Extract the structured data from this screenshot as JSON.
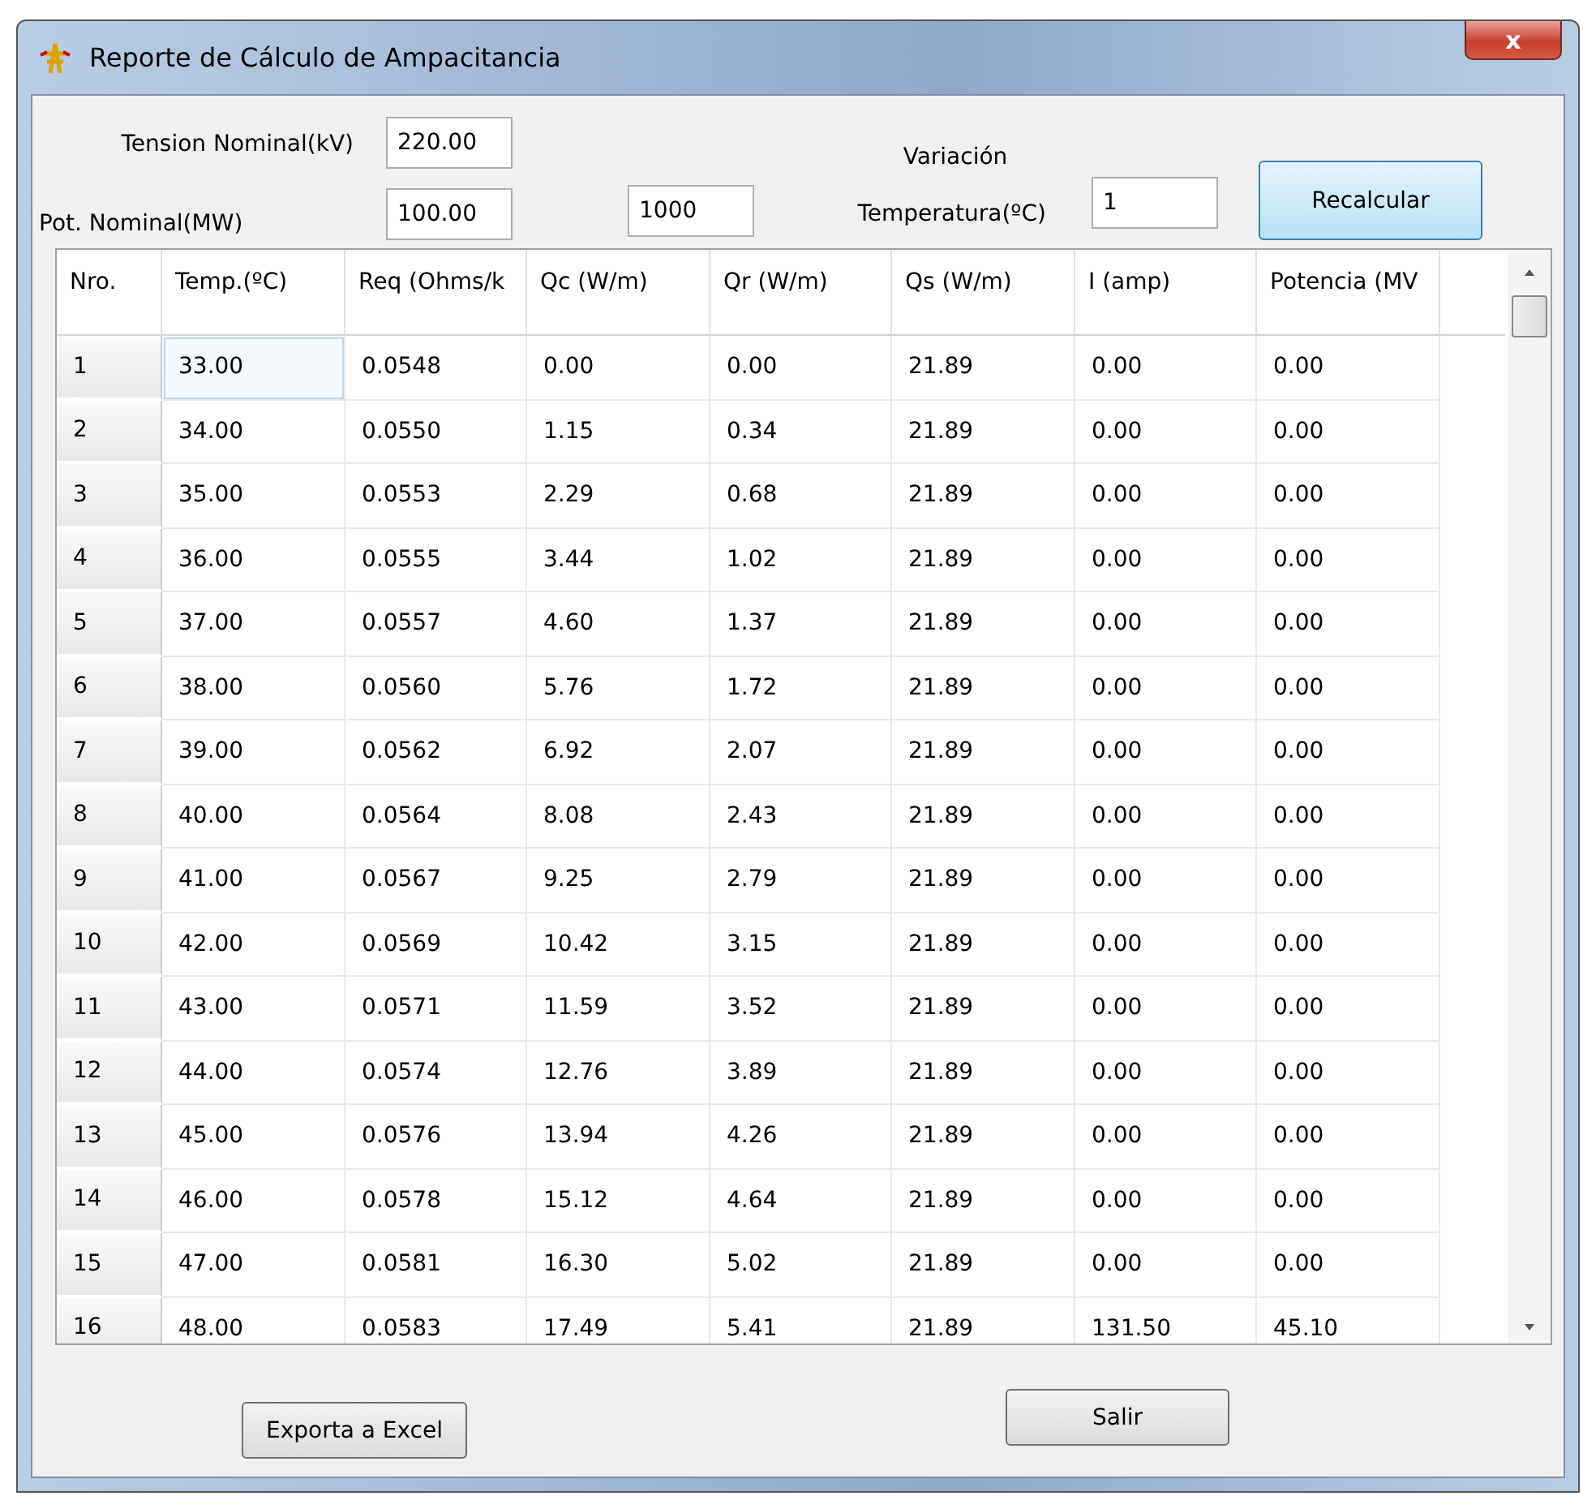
{
  "window": {
    "title": "Reporte de Cálculo de Ampacitancia",
    "close": "x"
  },
  "form": {
    "tension_label": "Tension Nominal(kV)",
    "tension_value": "220.00",
    "potencia_label": "Pot. Nominal(MW)",
    "potencia_value": "100.00",
    "field_3_value": "1000",
    "variacion_label_1": "Variación",
    "variacion_label_2": "Temperatura(ºC)",
    "variacion_value": "1",
    "recalc_button": "Recalcular"
  },
  "table": {
    "columns": [
      "Nro.",
      "Temp.(ºC)",
      "Req (Ohms/k",
      "Qc (W/m)",
      "Qr (W/m)",
      "Qs  (W/m)",
      "I (amp)",
      "Potencia (MV"
    ],
    "rows": [
      {
        "cells": [
          "1",
          "33.00",
          "0.0548",
          "0.00",
          "0.00",
          "21.89",
          "0.00",
          "0.00"
        ],
        "selected": true
      },
      {
        "cells": [
          "2",
          "34.00",
          "0.0550",
          "1.15",
          "0.34",
          "21.89",
          "0.00",
          "0.00"
        ],
        "selected": false
      },
      {
        "cells": [
          "3",
          "35.00",
          "0.0553",
          "2.29",
          "0.68",
          "21.89",
          "0.00",
          "0.00"
        ],
        "selected": false
      },
      {
        "cells": [
          "4",
          "36.00",
          "0.0555",
          "3.44",
          "1.02",
          "21.89",
          "0.00",
          "0.00"
        ],
        "selected": false
      },
      {
        "cells": [
          "5",
          "37.00",
          "0.0557",
          "4.60",
          "1.37",
          "21.89",
          "0.00",
          "0.00"
        ],
        "selected": false
      },
      {
        "cells": [
          "6",
          "38.00",
          "0.0560",
          "5.76",
          "1.72",
          "21.89",
          "0.00",
          "0.00"
        ],
        "selected": false
      },
      {
        "cells": [
          "7",
          "39.00",
          "0.0562",
          "6.92",
          "2.07",
          "21.89",
          "0.00",
          "0.00"
        ],
        "selected": false
      },
      {
        "cells": [
          "8",
          "40.00",
          "0.0564",
          "8.08",
          "2.43",
          "21.89",
          "0.00",
          "0.00"
        ],
        "selected": false
      },
      {
        "cells": [
          "9",
          "41.00",
          "0.0567",
          "9.25",
          "2.79",
          "21.89",
          "0.00",
          "0.00"
        ],
        "selected": false
      },
      {
        "cells": [
          "10",
          "42.00",
          "0.0569",
          "10.42",
          "3.15",
          "21.89",
          "0.00",
          "0.00"
        ],
        "selected": false
      },
      {
        "cells": [
          "11",
          "43.00",
          "0.0571",
          "11.59",
          "3.52",
          "21.89",
          "0.00",
          "0.00"
        ],
        "selected": false
      },
      {
        "cells": [
          "12",
          "44.00",
          "0.0574",
          "12.76",
          "3.89",
          "21.89",
          "0.00",
          "0.00"
        ],
        "selected": false
      },
      {
        "cells": [
          "13",
          "45.00",
          "0.0576",
          "13.94",
          "4.26",
          "21.89",
          "0.00",
          "0.00"
        ],
        "selected": false
      },
      {
        "cells": [
          "14",
          "46.00",
          "0.0578",
          "15.12",
          "4.64",
          "21.89",
          "0.00",
          "0.00"
        ],
        "selected": false
      },
      {
        "cells": [
          "15",
          "47.00",
          "0.0581",
          "16.30",
          "5.02",
          "21.89",
          "0.00",
          "0.00"
        ],
        "selected": false
      },
      {
        "cells": [
          "16",
          "48.00",
          "0.0583",
          "17.49",
          "5.41",
          "21.89",
          "131.50",
          "45.10"
        ],
        "selected": false
      }
    ]
  },
  "buttons": {
    "export": "Exporta a Excel",
    "exit": "Salir"
  }
}
